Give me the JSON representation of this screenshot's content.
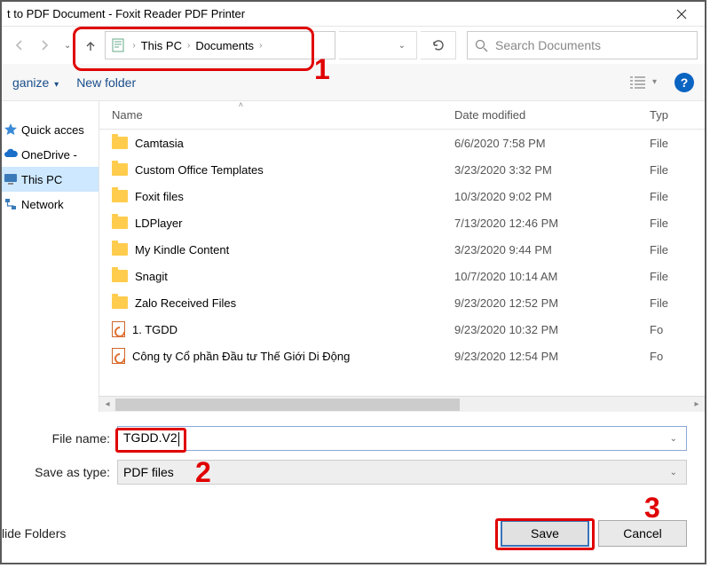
{
  "title": "t to PDF Document - Foxit Reader PDF Printer",
  "breadcrumb": {
    "part1": "This PC",
    "part2": "Documents"
  },
  "search": {
    "placeholder": "Search Documents"
  },
  "toolbar": {
    "organize": "ganize",
    "new_folder": "New folder"
  },
  "columns": {
    "name": "Name",
    "date": "Date modified",
    "type": "Typ"
  },
  "sidebar": {
    "quick": "Quick acces",
    "onedrive": "OneDrive -",
    "thispc": "This PC",
    "network": "Network"
  },
  "files": [
    {
      "name": "Camtasia",
      "date": "6/6/2020 7:58 PM",
      "type": "File",
      "kind": "folder"
    },
    {
      "name": "Custom Office Templates",
      "date": "3/23/2020 3:32 PM",
      "type": "File",
      "kind": "folder"
    },
    {
      "name": "Foxit files",
      "date": "10/3/2020 9:02 PM",
      "type": "File",
      "kind": "folder"
    },
    {
      "name": "LDPlayer",
      "date": "7/13/2020 12:46 PM",
      "type": "File",
      "kind": "folder"
    },
    {
      "name": "My Kindle Content",
      "date": "3/23/2020 9:44 PM",
      "type": "File",
      "kind": "folder"
    },
    {
      "name": "Snagit",
      "date": "10/7/2020 10:14 AM",
      "type": "File",
      "kind": "folder"
    },
    {
      "name": "Zalo Received Files",
      "date": "9/23/2020 12:52 PM",
      "type": "File",
      "kind": "folder"
    },
    {
      "name": "1. TGDD",
      "date": "9/23/2020 10:32 PM",
      "type": "Fo",
      "kind": "pdf"
    },
    {
      "name": "Công ty Cổ phần Đầu tư Thế Giới Di Động",
      "date": "9/23/2020 12:54 PM",
      "type": "Fo",
      "kind": "pdf"
    }
  ],
  "form": {
    "filename_label": "File name:",
    "filename_value": "TGDD.V2",
    "savetype_label": "Save as type:",
    "savetype_value": "PDF files"
  },
  "footer": {
    "hide_folders": "lide Folders",
    "save": "Save",
    "cancel": "Cancel"
  },
  "annotations": {
    "n1": "1",
    "n2": "2",
    "n3": "3"
  }
}
